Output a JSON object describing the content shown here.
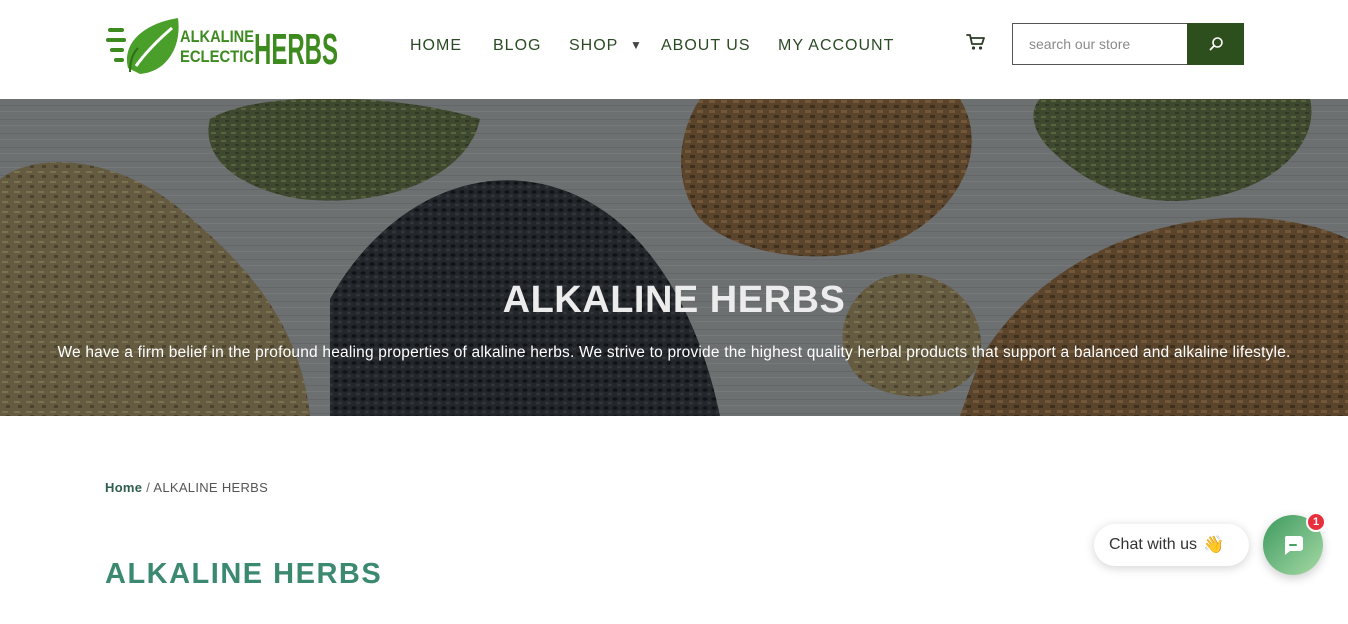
{
  "brand": {
    "logo_line1": "ALKALINE",
    "logo_line2": "ECLECTIC",
    "logo_word": "HERBS"
  },
  "nav": {
    "items": [
      {
        "label": "HOME"
      },
      {
        "label": "BLOG"
      },
      {
        "label": "SHOP"
      },
      {
        "label": "ABOUT US"
      },
      {
        "label": "MY ACCOUNT"
      }
    ],
    "shop_caret": "▼"
  },
  "search": {
    "placeholder": "search our store"
  },
  "hero": {
    "title": "ALKALINE HERBS",
    "text": "We have a firm belief in the profound healing properties of alkaline herbs.  We strive to provide the highest quality herbal products that support a balanced and alkaline lifestyle."
  },
  "breadcrumb": {
    "home": "Home",
    "separator": " / ",
    "current": "ALKALINE HERBS"
  },
  "page": {
    "title": "ALKALINE HERBS"
  },
  "chat": {
    "label": "Chat with us",
    "emoji": "👋",
    "badge": "1"
  },
  "icons": {
    "cart": "cart-icon",
    "search": "search-icon",
    "chat": "chat-bubble-icon",
    "leaf": "leaf-icon"
  },
  "colors": {
    "brand_green": "#3d8a1f",
    "dark_green": "#2d4f1e",
    "title_green": "#3b8a6f",
    "nav_text": "#2b4a25",
    "badge_red": "#e8303d"
  }
}
